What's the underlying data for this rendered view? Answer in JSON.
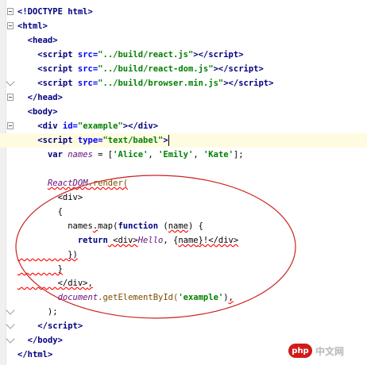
{
  "lines": [
    {
      "segments": [
        {
          "t": "<!DOCTYPE ",
          "c": "tag"
        },
        {
          "t": "html",
          "c": "tag"
        },
        {
          "t": ">",
          "c": "tag"
        }
      ]
    },
    {
      "segments": [
        {
          "t": "<",
          "c": "tag"
        },
        {
          "t": "html",
          "c": "tag"
        },
        {
          "t": ">",
          "c": "tag"
        }
      ]
    },
    {
      "segments": [
        {
          "t": "  <",
          "c": "tag"
        },
        {
          "t": "head",
          "c": "tag"
        },
        {
          "t": ">",
          "c": "tag"
        }
      ]
    },
    {
      "segments": [
        {
          "t": "    <",
          "c": "tag"
        },
        {
          "t": "script ",
          "c": "tag"
        },
        {
          "t": "src=",
          "c": "attr"
        },
        {
          "t": "\"../build/react.js\"",
          "c": "str"
        },
        {
          "t": "></",
          "c": "tag"
        },
        {
          "t": "script",
          "c": "tag"
        },
        {
          "t": ">",
          "c": "tag"
        }
      ]
    },
    {
      "segments": [
        {
          "t": "    <",
          "c": "tag"
        },
        {
          "t": "script ",
          "c": "tag"
        },
        {
          "t": "src=",
          "c": "attr"
        },
        {
          "t": "\"../build/react-dom.js\"",
          "c": "str"
        },
        {
          "t": "></",
          "c": "tag"
        },
        {
          "t": "script",
          "c": "tag"
        },
        {
          "t": ">",
          "c": "tag"
        }
      ]
    },
    {
      "segments": [
        {
          "t": "    <",
          "c": "tag"
        },
        {
          "t": "script ",
          "c": "tag"
        },
        {
          "t": "src=",
          "c": "attr"
        },
        {
          "t": "\"../build/browser.min.js\"",
          "c": "str"
        },
        {
          "t": "></",
          "c": "tag"
        },
        {
          "t": "script",
          "c": "tag"
        },
        {
          "t": ">",
          "c": "tag"
        }
      ]
    },
    {
      "segments": [
        {
          "t": "  </",
          "c": "tag"
        },
        {
          "t": "head",
          "c": "tag"
        },
        {
          "t": ">",
          "c": "tag"
        }
      ]
    },
    {
      "segments": [
        {
          "t": "  <",
          "c": "tag"
        },
        {
          "t": "body",
          "c": "tag"
        },
        {
          "t": ">",
          "c": "tag"
        }
      ]
    },
    {
      "segments": [
        {
          "t": "    <",
          "c": "tag"
        },
        {
          "t": "div ",
          "c": "tag"
        },
        {
          "t": "id=",
          "c": "attr"
        },
        {
          "t": "\"example\"",
          "c": "str"
        },
        {
          "t": "></",
          "c": "tag"
        },
        {
          "t": "div",
          "c": "tag"
        },
        {
          "t": ">",
          "c": "tag"
        }
      ]
    },
    {
      "segments": [
        {
          "t": "    <",
          "c": "tag"
        },
        {
          "t": "script ",
          "c": "tag"
        },
        {
          "t": "type=",
          "c": "attr"
        },
        {
          "t": "\"text/babel\"",
          "c": "str"
        },
        {
          "t": ">",
          "c": "tag"
        }
      ]
    },
    {
      "segments": [
        {
          "t": "      ",
          "c": ""
        },
        {
          "t": "var ",
          "c": "kw"
        },
        {
          "t": "names",
          "c": "ident"
        },
        {
          "t": " = [",
          "c": ""
        },
        {
          "t": "'Alice'",
          "c": "str"
        },
        {
          "t": ", ",
          "c": ""
        },
        {
          "t": "'Emily'",
          "c": "str"
        },
        {
          "t": ", ",
          "c": ""
        },
        {
          "t": "'Kate'",
          "c": "str"
        },
        {
          "t": "];",
          "c": ""
        }
      ]
    },
    {
      "segments": []
    },
    {
      "segments": [
        {
          "t": "      ",
          "c": ""
        },
        {
          "t": "ReactDOM",
          "c": "ident sq"
        },
        {
          "t": ".render(",
          "c": "call sq"
        }
      ]
    },
    {
      "segments": [
        {
          "t": "        <div>",
          "c": ""
        }
      ]
    },
    {
      "segments": [
        {
          "t": "        {",
          "c": ""
        }
      ]
    },
    {
      "segments": [
        {
          "t": "          names",
          "c": ""
        },
        {
          "t": ".",
          "c": "sq"
        },
        {
          "t": "map(",
          "c": ""
        },
        {
          "t": "function",
          "c": "kw"
        },
        {
          "t": " (",
          "c": ""
        },
        {
          "t": "name",
          "c": "sq"
        },
        {
          "t": ") {",
          "c": ""
        }
      ]
    },
    {
      "segments": [
        {
          "t": "            ",
          "c": ""
        },
        {
          "t": "return",
          "c": "kw"
        },
        {
          "t": " <div>",
          "c": "sq"
        },
        {
          "t": "Hello",
          "c": "ident"
        },
        {
          "t": ", {",
          "c": ""
        },
        {
          "t": "name",
          "c": "sq"
        },
        {
          "t": "}!</div>",
          "c": "sq"
        }
      ]
    },
    {
      "segments": [
        {
          "t": "          })",
          "c": "sq"
        }
      ]
    },
    {
      "segments": [
        {
          "t": "        }",
          "c": "sq"
        }
      ]
    },
    {
      "segments": [
        {
          "t": "        </div>",
          "c": "sq"
        },
        {
          "t": ",",
          "c": "sq"
        }
      ]
    },
    {
      "segments": [
        {
          "t": "        ",
          "c": ""
        },
        {
          "t": "document",
          "c": "ident"
        },
        {
          "t": ".getElementById(",
          "c": "call"
        },
        {
          "t": "'example'",
          "c": "str"
        },
        {
          "t": ")",
          "c": ""
        },
        {
          "t": ",",
          "c": "sq"
        }
      ]
    },
    {
      "segments": [
        {
          "t": "      );",
          "c": ""
        }
      ]
    },
    {
      "segments": [
        {
          "t": "    </",
          "c": "tag"
        },
        {
          "t": "script",
          "c": "tag"
        },
        {
          "t": ">",
          "c": "tag"
        }
      ]
    },
    {
      "segments": [
        {
          "t": "  </",
          "c": "tag"
        },
        {
          "t": "body",
          "c": "tag"
        },
        {
          "t": ">",
          "c": "tag"
        }
      ]
    },
    {
      "segments": [
        {
          "t": "</",
          "c": "tag"
        },
        {
          "t": "html",
          "c": "tag"
        },
        {
          "t": ">",
          "c": "tag"
        }
      ]
    }
  ],
  "current_line_index": 9,
  "folds": [
    {
      "line": 1,
      "kind": "open"
    },
    {
      "line": 2,
      "kind": "open"
    },
    {
      "line": 6,
      "kind": "close"
    },
    {
      "line": 7,
      "kind": "open"
    },
    {
      "line": 9,
      "kind": "open"
    },
    {
      "line": 22,
      "kind": "close"
    },
    {
      "line": 23,
      "kind": "close"
    },
    {
      "line": 24,
      "kind": "close"
    }
  ],
  "colors": {
    "annotation_ellipse": "#cc2222",
    "current_line": "#fffbe0"
  },
  "watermark": {
    "logo_text": "php",
    "site_text": "中文网"
  }
}
